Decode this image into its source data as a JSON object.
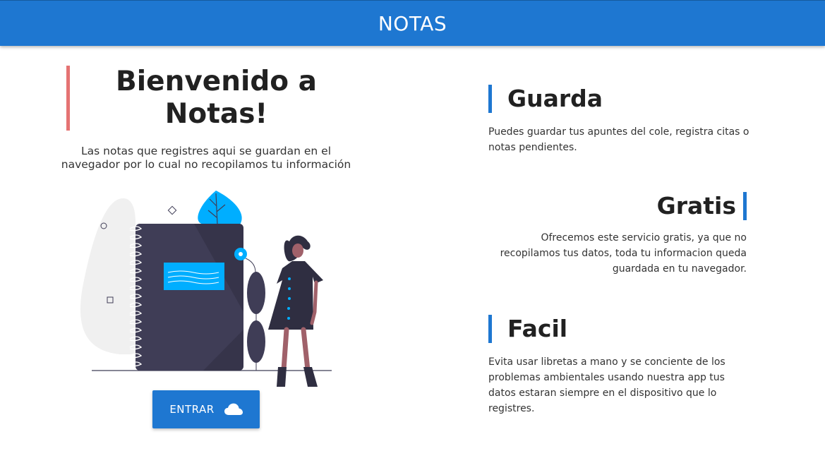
{
  "header": {
    "title": "NOTAS"
  },
  "welcome": {
    "title": "Bienvenido a Notas!",
    "description": "Las notas que registres aqui se guardan en el navegador por lo cual no recopilamos tu información",
    "button_label": "ENTRAR",
    "button_icon": "cloud-icon"
  },
  "features": [
    {
      "heading": "Guarda",
      "text": "Puedes guardar tus apuntes del cole, registra citas o notas pendientes."
    },
    {
      "heading": "Gratis",
      "text": "Ofrecemos este servicio gratis, ya que no recopilamos tus datos, toda tu informacion queda guardada en tu navegador."
    },
    {
      "heading": "Facil",
      "text": "Evita usar libretas a mano y se conciente de los problemas ambientales usando nuestra app tus datos estaran siempre en el dispositivo que lo registres."
    }
  ],
  "colors": {
    "primary": "#1e77d1",
    "accent_red": "#e57373",
    "notebook": "#3f3d56",
    "highlight": "#00aeff"
  }
}
